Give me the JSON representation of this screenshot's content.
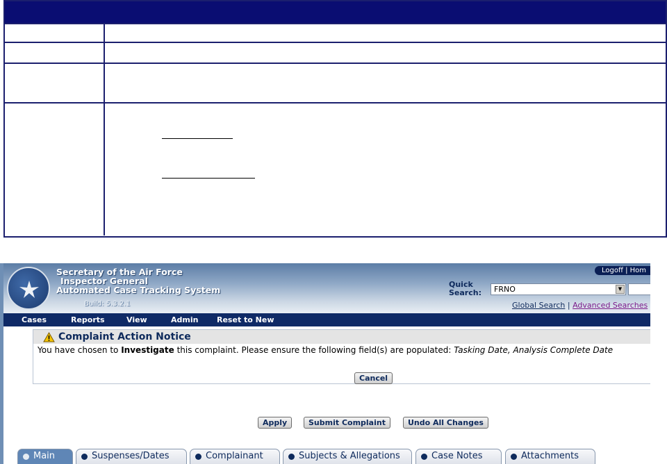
{
  "app": {
    "brand_line1": "Secretary of the Air Force",
    "brand_line2": "Inspector General",
    "brand_line3": "Automated Case Tracking System",
    "build": "Build: 5.3.2.1",
    "logoff": "Logoff  |  Hom",
    "quick_search_label_1": "Quick",
    "quick_search_label_2": "Search:",
    "quick_search_value": "FRNO",
    "global_search": "Global Search",
    "separator": " | ",
    "advanced_searches": "Advanced Searches",
    "menu": [
      "Cases",
      "Reports",
      "View",
      "Admin",
      "Reset to New"
    ]
  },
  "notice": {
    "title": "Complaint Action Notice",
    "msg_prefix": "You have chosen to ",
    "msg_action": "Investigate",
    "msg_middle": " this complaint. Please ensure the following field(s) are populated: ",
    "msg_fields": "Tasking Date, Analysis Complete Date",
    "cancel_label": "Cancel"
  },
  "actions": {
    "apply": "Apply",
    "submit": "Submit Complaint",
    "undo": "Undo All Changes"
  },
  "tabs": [
    "Main",
    "Suspenses/Dates",
    "Complainant",
    "Subjects & Allegations",
    "Case Notes",
    "Attachments"
  ],
  "colors": {
    "doc_header": "#0a0d72",
    "menubar": "#0f2a66",
    "active_tab": "#5f86b6"
  },
  "icons": {
    "seal": "air-force-seal-icon",
    "warning": "warning-icon",
    "tab_bullet": "bullet-icon",
    "dropdown": "chevron-down-icon"
  }
}
